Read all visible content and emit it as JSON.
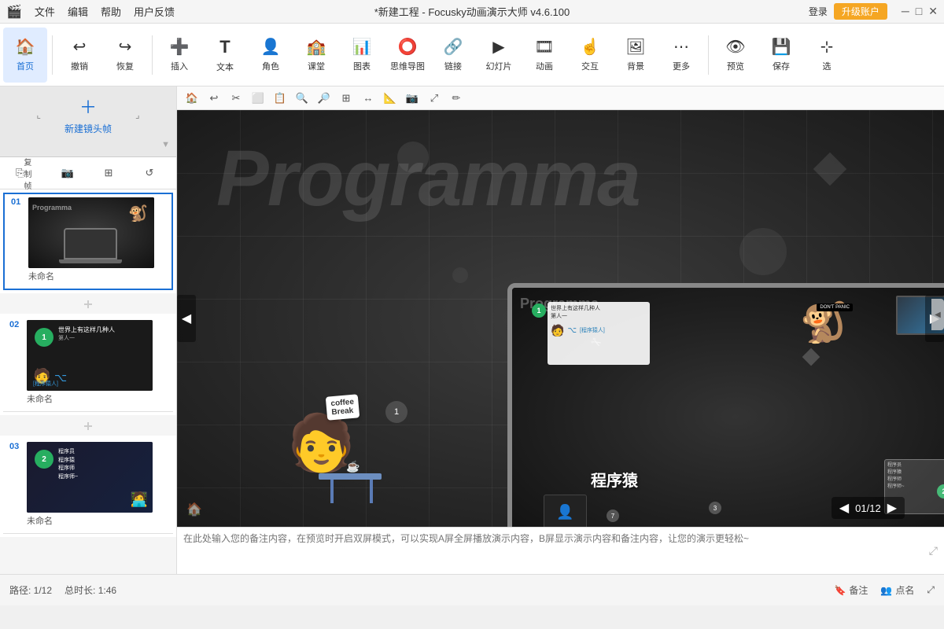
{
  "titlebar": {
    "menu_items": [
      "文件",
      "编辑",
      "帮助",
      "用户反馈"
    ],
    "title": "*新建工程 - Focusky动画演示大师 v4.6.100",
    "login_label": "登录",
    "upgrade_label": "升级账户",
    "win_min": "─",
    "win_max": "□",
    "win_close": "✕"
  },
  "toolbar": {
    "items": [
      {
        "id": "home",
        "label": "首页",
        "icon": "🏠"
      },
      {
        "id": "undo",
        "label": "撤销",
        "icon": "↩"
      },
      {
        "id": "redo",
        "label": "恢复",
        "icon": "↪"
      },
      {
        "id": "insert",
        "label": "插入",
        "icon": "＋"
      },
      {
        "id": "text",
        "label": "文本",
        "icon": "T"
      },
      {
        "id": "role",
        "label": "角色",
        "icon": "👤"
      },
      {
        "id": "class",
        "label": "课堂",
        "icon": "🏫"
      },
      {
        "id": "chart",
        "label": "图表",
        "icon": "📊"
      },
      {
        "id": "mindmap",
        "label": "思维导图",
        "icon": "🔀"
      },
      {
        "id": "link",
        "label": "链接",
        "icon": "🔗"
      },
      {
        "id": "slideshow",
        "label": "幻灯片",
        "icon": "▶"
      },
      {
        "id": "animation",
        "label": "动画",
        "icon": "🎬"
      },
      {
        "id": "interact",
        "label": "交互",
        "icon": "☝"
      },
      {
        "id": "bg",
        "label": "背景",
        "icon": "🖼"
      },
      {
        "id": "more",
        "label": "更多",
        "icon": "⋯"
      },
      {
        "id": "preview",
        "label": "预览",
        "icon": "👁"
      },
      {
        "id": "save",
        "label": "保存",
        "icon": "💾"
      },
      {
        "id": "select",
        "label": "选",
        "icon": "⊹"
      }
    ]
  },
  "icon_toolbar": {
    "icons": [
      "🏠",
      "↩",
      "↰",
      "⬜",
      "⬛",
      "🔍",
      "🔎",
      "⊞",
      "↔",
      "📐",
      "📷",
      "⤢",
      "✏"
    ]
  },
  "sidebar": {
    "new_frame_label": "新建镜头帧",
    "tools": [
      "复制帧",
      "📷",
      "⊞",
      "↺"
    ],
    "frames": [
      {
        "number": "01",
        "label": "未命名",
        "title_text": "Programma",
        "active": true
      },
      {
        "number": "02",
        "label": "未命名",
        "title_text": "世界上有这样几种人",
        "active": false
      },
      {
        "number": "03",
        "label": "未命名",
        "title_text": "",
        "active": false
      }
    ]
  },
  "canvas": {
    "main_title": "Programma",
    "chengxuyuan": "程序猿",
    "slide_num": "1",
    "coffee_break": "coffee\nBreak"
  },
  "notes": {
    "placeholder": "在此处输入您的备注内容，在预览时开启双屏模式，可以实现A屏全屏播放演示内容，B屏显示演示内容和备注内容，让您的演示更轻松~"
  },
  "statusbar": {
    "path_label": "路径: 1/12",
    "duration_label": "总时长: 1:46",
    "notes_btn": "备注",
    "point_btn": "点名",
    "expand_icon": "⤢"
  },
  "slide_counter": {
    "prev": "◀",
    "counter": "01/12",
    "next": "▶"
  }
}
